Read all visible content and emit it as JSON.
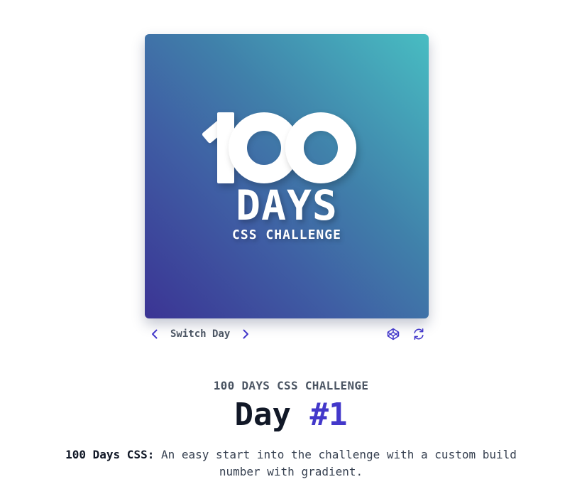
{
  "card": {
    "logo": {
      "number": "100",
      "word": "DAYS",
      "subtitle": "CSS CHALLENGE"
    },
    "gradient": {
      "start": "#3b3494",
      "end": "#48bdc2"
    }
  },
  "controls": {
    "switch_label": "Switch Day",
    "prev_icon": "chevron-left-icon",
    "next_icon": "chevron-right-icon",
    "codepen_icon": "codepen-icon",
    "refresh_icon": "refresh-icon",
    "accent": "#4338ca"
  },
  "content": {
    "eyebrow": "100 DAYS CSS CHALLENGE",
    "title_prefix": "Day",
    "title_number": "#1",
    "description_lead": "100 Days CSS:",
    "description_text": "An easy start into the challenge with a custom build number with gradient."
  }
}
